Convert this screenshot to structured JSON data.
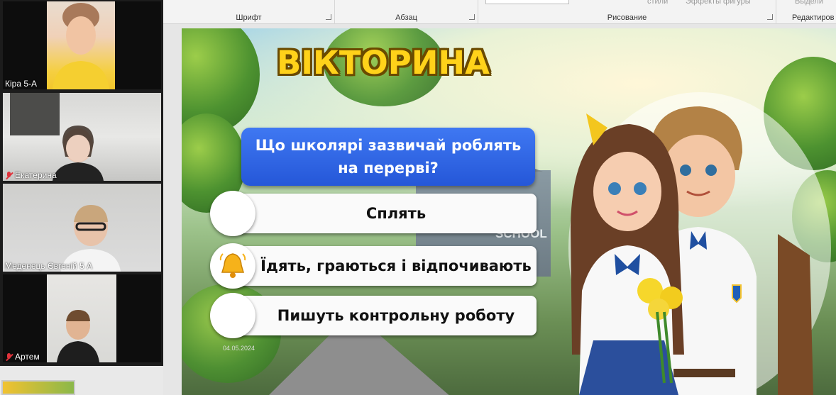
{
  "ribbon": {
    "groups": [
      {
        "label": "Шрифт"
      },
      {
        "label": "Абзац"
      },
      {
        "label": "Рисование"
      },
      {
        "label": "Редактиров"
      }
    ],
    "faint_items": [
      "стили",
      "Эффекты фигуры",
      "Выдели"
    ]
  },
  "participants": [
    {
      "name": "Кіра 5-А",
      "muted": false
    },
    {
      "name": "Екатерина",
      "muted": true
    },
    {
      "name": "Меденець Євгеній 5 А",
      "muted": false
    },
    {
      "name": "Артем",
      "muted": true
    }
  ],
  "slide": {
    "title": "ВІКТОРИНА",
    "question": "Що школярі зазвичай роблять на перерві?",
    "answers": [
      {
        "text": "Сплять",
        "icon": "none"
      },
      {
        "text": "Їдять, граються і відпочивають",
        "icon": "bell-icon"
      },
      {
        "text": "Пишуть контрольну роботу",
        "icon": "none"
      }
    ],
    "school_sign": "SCHOOL",
    "date_text": "04.05.2024"
  },
  "colors": {
    "title_yellow": "#ffd21a",
    "question_blue": "#2f66e6",
    "answer_bg": "#fafafa",
    "mute_red": "#e0323b"
  }
}
